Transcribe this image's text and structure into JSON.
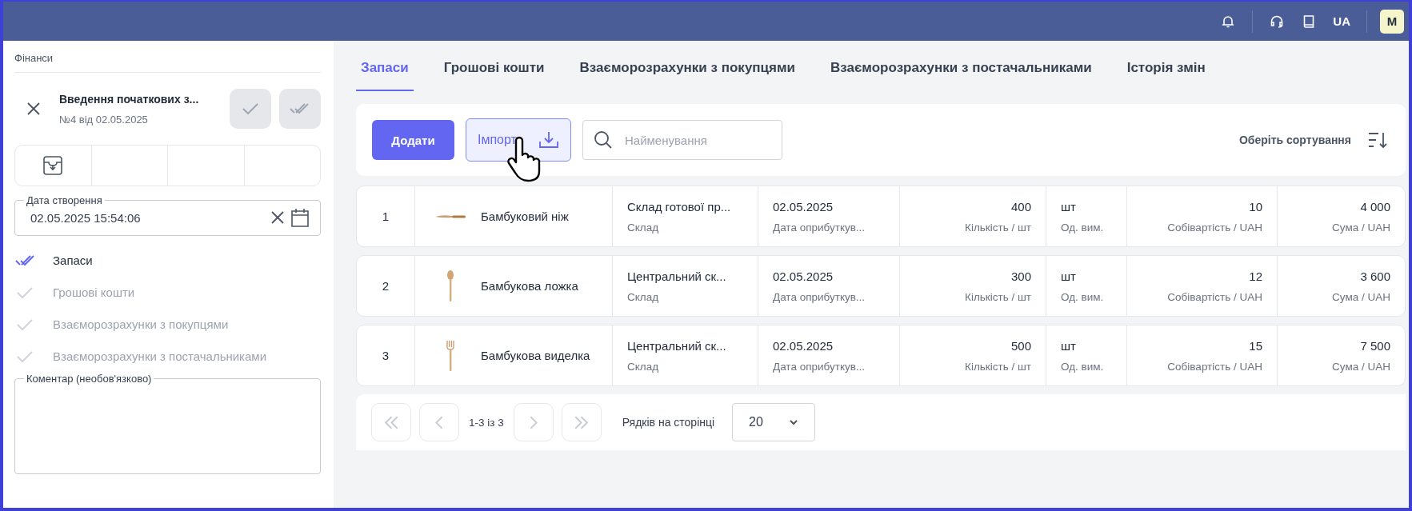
{
  "header": {
    "language": "UA",
    "avatar": "M"
  },
  "sidebar": {
    "breadcrumb": "Фінанси",
    "document": {
      "title": "Введення початкових з...",
      "subtitle": "№4 від 02.05.2025"
    },
    "created": {
      "label": "Дата створення",
      "value": "02.05.2025 15:54:06"
    },
    "steps": [
      {
        "label": "Запаси",
        "selected": true
      },
      {
        "label": "Грошові кошти",
        "selected": false
      },
      {
        "label": "Взаєморозрахунки з покупцями",
        "selected": false
      },
      {
        "label": "Взаєморозрахунки з постачальниками",
        "selected": false
      }
    ],
    "comment": {
      "label": "Коментар (необов'язково)"
    }
  },
  "tabs": [
    {
      "label": "Запаси",
      "selected": true
    },
    {
      "label": "Грошові кошти",
      "selected": false
    },
    {
      "label": "Взаєморозрахунки з покупцями",
      "selected": false
    },
    {
      "label": "Взаєморозрахунки з постачальниками",
      "selected": false
    },
    {
      "label": "Історія змін",
      "selected": false
    }
  ],
  "toolbar": {
    "add": "Додати",
    "import": "Імпорт",
    "search": {
      "placeholder": "Найменування"
    },
    "sort": "Оберіть сортування"
  },
  "rows": [
    {
      "number": "1",
      "kind": "knife",
      "product": "Бамбуковий ніж",
      "warehouse": "Склад готової пр...",
      "warehouse_label": "Склад",
      "date": "02.05.2025",
      "date_label": "Дата оприбуткув...",
      "quantity": "400",
      "quantity_label": "Кількість / шт",
      "unit": "шт",
      "unit_label": "Од. вим.",
      "cost": "10",
      "cost_label": "Собівартість / UAH",
      "sum": "4 000",
      "sum_label": "Сума / UAH"
    },
    {
      "number": "2",
      "kind": "spoon",
      "product": "Бамбукова ложка",
      "warehouse": "Центральний ск...",
      "warehouse_label": "Склад",
      "date": "02.05.2025",
      "date_label": "Дата оприбуткув...",
      "quantity": "300",
      "quantity_label": "Кількість / шт",
      "unit": "шт",
      "unit_label": "Од. вим.",
      "cost": "12",
      "cost_label": "Собівартість / UAH",
      "sum": "3 600",
      "sum_label": "Сума / UAH"
    },
    {
      "number": "3",
      "kind": "fork",
      "product": "Бамбукова виделка",
      "warehouse": "Центральний ск...",
      "warehouse_label": "Склад",
      "date": "02.05.2025",
      "date_label": "Дата оприбуткув...",
      "quantity": "500",
      "quantity_label": "Кількість / шт",
      "unit": "шт",
      "unit_label": "Од. вим.",
      "cost": "15",
      "cost_label": "Собівартість / UAH",
      "sum": "7 500",
      "sum_label": "Сума / UAH"
    }
  ],
  "pagination": {
    "buttons": [
      {
        "kind": "first",
        "disabled": true
      },
      {
        "kind": "prev",
        "disabled": true
      },
      {
        "kind": "next",
        "disabled": true
      },
      {
        "kind": "last",
        "disabled": true
      }
    ],
    "range": "1-3 із 3",
    "rows_label": "Рядків на сторінці",
    "page_size": "20"
  }
}
